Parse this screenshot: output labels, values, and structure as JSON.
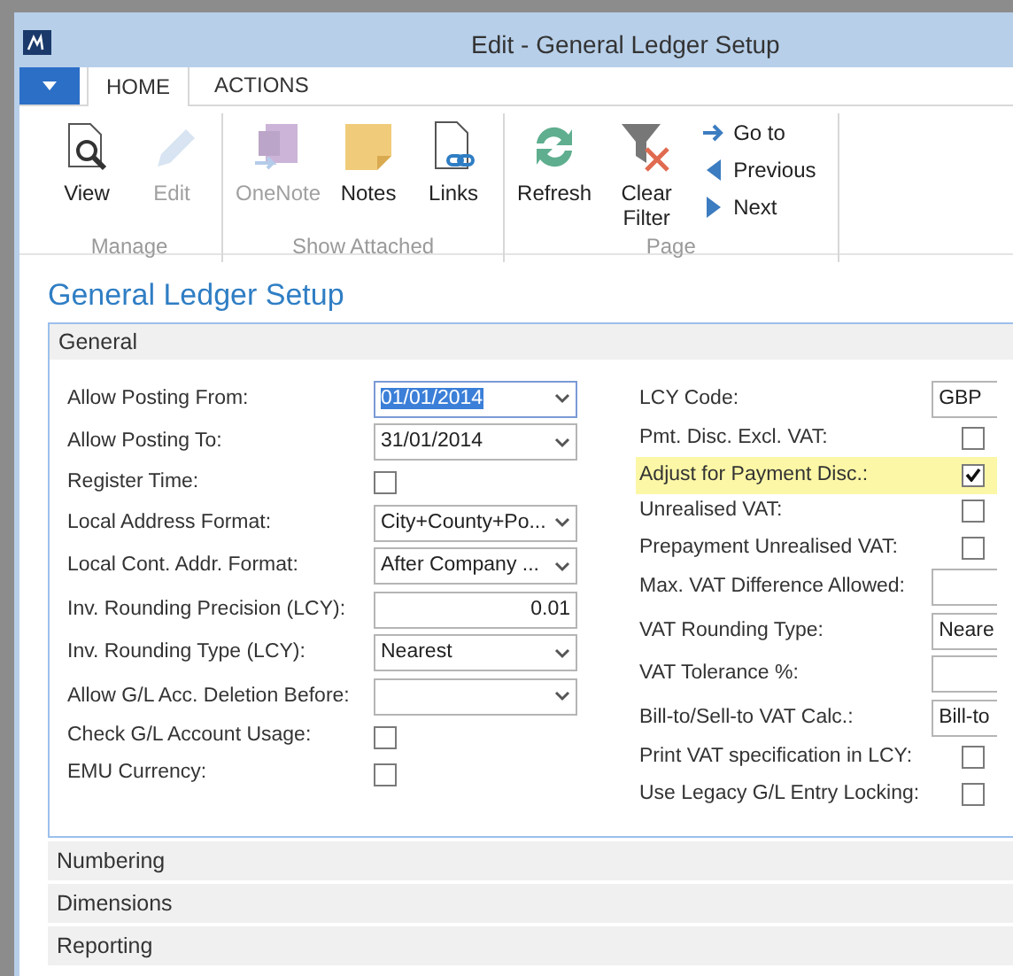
{
  "window": {
    "title": "Edit - General Ledger Setup"
  },
  "tabs": [
    {
      "label": "HOME",
      "selected": true
    },
    {
      "label": "ACTIONS",
      "selected": false
    }
  ],
  "ribbon": {
    "groups": [
      {
        "label": "Manage",
        "buttons": [
          {
            "kind": "large",
            "label": "View",
            "disabled": false
          },
          {
            "kind": "large",
            "label": "Edit",
            "disabled": true
          }
        ]
      },
      {
        "label": "Show Attached",
        "buttons": [
          {
            "kind": "large",
            "label": "OneNote",
            "disabled": true
          },
          {
            "kind": "large",
            "label": "Notes",
            "disabled": false
          },
          {
            "kind": "large",
            "label": "Links",
            "disabled": false
          }
        ]
      },
      {
        "label": "Page",
        "buttons": [
          {
            "kind": "large",
            "label": "Refresh",
            "disabled": false
          },
          {
            "kind": "large",
            "label": "Clear Filter",
            "disabled": false
          },
          {
            "kind": "small",
            "label": "Go to",
            "disabled": false
          },
          {
            "kind": "small",
            "label": "Previous",
            "disabled": false
          },
          {
            "kind": "small",
            "label": "Next",
            "disabled": false
          }
        ]
      }
    ]
  },
  "page_title": "General Ledger Setup",
  "general": {
    "title": "General",
    "left": [
      {
        "label": "Allow Posting From:",
        "kind": "dropdown",
        "value": "01/01/2014",
        "focused": true
      },
      {
        "label": "Allow Posting To:",
        "kind": "dropdown",
        "value": "31/01/2014",
        "focused": false
      },
      {
        "label": "Register Time:",
        "kind": "checkbox",
        "checked": false
      },
      {
        "label": "Local Address Format:",
        "kind": "dropdown",
        "value": "City+County+Po...",
        "focused": false
      },
      {
        "label": "Local Cont. Addr. Format:",
        "kind": "dropdown",
        "value": "After Company ...",
        "focused": false
      },
      {
        "label": "Inv. Rounding Precision (LCY):",
        "kind": "number",
        "value": "0.01",
        "focused": false
      },
      {
        "label": "Inv. Rounding Type (LCY):",
        "kind": "dropdown",
        "value": "Nearest",
        "focused": false
      },
      {
        "label": "Allow G/L Acc. Deletion Before:",
        "kind": "dropdown",
        "focused": false
      },
      {
        "label": "Check G/L Account Usage:",
        "kind": "checkbox",
        "checked": false
      },
      {
        "label": "EMU Currency:",
        "kind": "checkbox",
        "checked": false
      }
    ],
    "right": [
      {
        "label": "LCY Code:",
        "kind": "text",
        "value": "GBP",
        "highlighted": false
      },
      {
        "label": "Pmt. Disc. Excl. VAT:",
        "kind": "checkbox",
        "checked": false,
        "highlighted": false
      },
      {
        "label": "Adjust for Payment Disc.:",
        "kind": "checkbox",
        "checked": true,
        "highlighted": true
      },
      {
        "label": "Unrealised VAT:",
        "kind": "checkbox",
        "checked": false,
        "highlighted": false
      },
      {
        "label": "Prepayment Unrealised VAT:",
        "kind": "checkbox",
        "checked": false,
        "highlighted": false
      },
      {
        "label": "Max. VAT Difference Allowed:",
        "kind": "text",
        "highlighted": false
      },
      {
        "label": "VAT Rounding Type:",
        "kind": "text",
        "value": "Neare",
        "highlighted": false
      },
      {
        "label": "VAT Tolerance %:",
        "kind": "text",
        "highlighted": false
      },
      {
        "label": "Bill-to/Sell-to VAT Calc.:",
        "kind": "text",
        "value": "Bill-to",
        "highlighted": false
      },
      {
        "label": "Print VAT specification in LCY:",
        "kind": "checkbox",
        "checked": false,
        "highlighted": false
      },
      {
        "label": "Use Legacy G/L Entry Locking:",
        "kind": "checkbox",
        "checked": false,
        "highlighted": false
      }
    ]
  },
  "sections": [
    "Numbering",
    "Dimensions",
    "Reporting"
  ]
}
